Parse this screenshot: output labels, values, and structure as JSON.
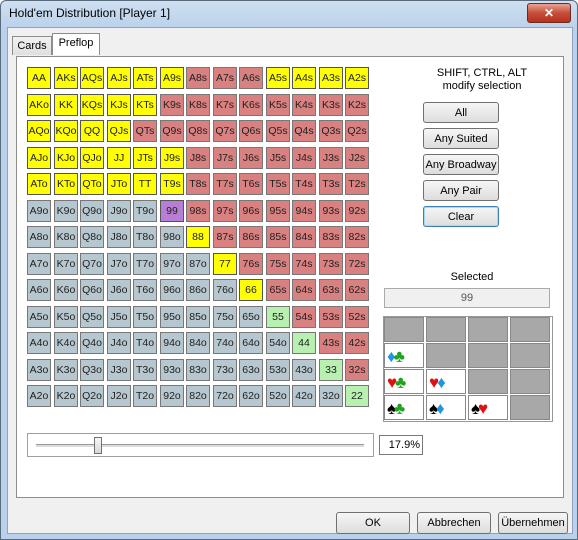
{
  "window": {
    "title": "Hold'em Distribution [Player 1]",
    "close_glyph": "✕"
  },
  "tabs": [
    {
      "label": "Cards",
      "active": false
    },
    {
      "label": "Preflop",
      "active": true
    }
  ],
  "grid": {
    "rows": [
      [
        "AA",
        "AKs",
        "AQs",
        "AJs",
        "ATs",
        "A9s",
        "A8s",
        "A7s",
        "A6s",
        "A5s",
        "A4s",
        "A3s",
        "A2s"
      ],
      [
        "AKo",
        "KK",
        "KQs",
        "KJs",
        "KTs",
        "K9s",
        "K8s",
        "K7s",
        "K6s",
        "K5s",
        "K4s",
        "K3s",
        "K2s"
      ],
      [
        "AQo",
        "KQo",
        "QQ",
        "QJs",
        "QTs",
        "Q9s",
        "Q8s",
        "Q7s",
        "Q6s",
        "Q5s",
        "Q4s",
        "Q3s",
        "Q2s"
      ],
      [
        "AJo",
        "KJo",
        "QJo",
        "JJ",
        "JTs",
        "J9s",
        "J8s",
        "J7s",
        "J6s",
        "J5s",
        "J4s",
        "J3s",
        "J2s"
      ],
      [
        "ATo",
        "KTo",
        "QTo",
        "JTo",
        "TT",
        "T9s",
        "T8s",
        "T7s",
        "T6s",
        "T5s",
        "T4s",
        "T3s",
        "T2s"
      ],
      [
        "A9o",
        "K9o",
        "Q9o",
        "J9o",
        "T9o",
        "99",
        "98s",
        "97s",
        "96s",
        "95s",
        "94s",
        "93s",
        "92s"
      ],
      [
        "A8o",
        "K8o",
        "Q8o",
        "J8o",
        "T8o",
        "98o",
        "88",
        "87s",
        "86s",
        "85s",
        "84s",
        "83s",
        "82s"
      ],
      [
        "A7o",
        "K7o",
        "Q7o",
        "J7o",
        "T7o",
        "97o",
        "87o",
        "77",
        "76s",
        "75s",
        "74s",
        "73s",
        "72s"
      ],
      [
        "A6o",
        "K6o",
        "Q6o",
        "J6o",
        "T6o",
        "96o",
        "86o",
        "76o",
        "66",
        "65s",
        "64s",
        "63s",
        "62s"
      ],
      [
        "A5o",
        "K5o",
        "Q5o",
        "J5o",
        "T5o",
        "95o",
        "85o",
        "75o",
        "65o",
        "55",
        "54s",
        "53s",
        "52s"
      ],
      [
        "A4o",
        "K4o",
        "Q4o",
        "J4o",
        "T4o",
        "94o",
        "84o",
        "74o",
        "64o",
        "54o",
        "44",
        "43s",
        "42s"
      ],
      [
        "A3o",
        "K3o",
        "Q3o",
        "J3o",
        "T3o",
        "93o",
        "83o",
        "73o",
        "63o",
        "53o",
        "43o",
        "33",
        "32s"
      ],
      [
        "A2o",
        "K2o",
        "Q2o",
        "J2o",
        "T2o",
        "92o",
        "82o",
        "72o",
        "62o",
        "52o",
        "42o",
        "32o",
        "22"
      ]
    ],
    "states": [
      "yyyyyyrrryyyy",
      "yyyyyrrrrrrrr",
      "yyyyrrrrrrrrr",
      "yyyyyyrrrrrrr",
      "yyyyyyrrrrrrr",
      "gggggprrrrrrr",
      "ggggggyrrrrrr",
      "gggggggyrrrrr",
      "ggggggggyrrrr",
      "gggggggggLrrr",
      "ggggggggggLrr",
      "gggggggggggLr",
      "ggggggggggggL"
    ]
  },
  "range_slider": {
    "value_percent": 17.9,
    "display": "17.9%"
  },
  "info": {
    "line1": "SHIFT, CTRL, ALT",
    "line2": "modify selection"
  },
  "buttons": {
    "all": "All",
    "any_suited": "Any Suited",
    "any_broadway": "Any Broadway",
    "any_pair": "Any Pair",
    "clear": "Clear"
  },
  "selected": {
    "label": "Selected",
    "value": "99"
  },
  "combos": [
    {
      "row": 1,
      "col": 0,
      "suits": [
        "♦",
        "♣"
      ],
      "colors": [
        "blue",
        "green"
      ],
      "enabled": true
    },
    {
      "row": 2,
      "col": 0,
      "suits": [
        "♥",
        "♣"
      ],
      "colors": [
        "red",
        "green"
      ],
      "enabled": true
    },
    {
      "row": 2,
      "col": 1,
      "suits": [
        "♥",
        "♦"
      ],
      "colors": [
        "red",
        "blue"
      ],
      "enabled": true
    },
    {
      "row": 3,
      "col": 0,
      "suits": [
        "♠",
        "♣"
      ],
      "colors": [
        "black",
        "green"
      ],
      "enabled": true
    },
    {
      "row": 3,
      "col": 1,
      "suits": [
        "♠",
        "♦"
      ],
      "colors": [
        "black",
        "blue"
      ],
      "enabled": true
    },
    {
      "row": 3,
      "col": 2,
      "suits": [
        "♠",
        "♥"
      ],
      "colors": [
        "black",
        "red"
      ],
      "enabled": true
    }
  ],
  "footer": {
    "ok": "OK",
    "cancel": "Abbrechen",
    "apply": "Übernehmen"
  }
}
